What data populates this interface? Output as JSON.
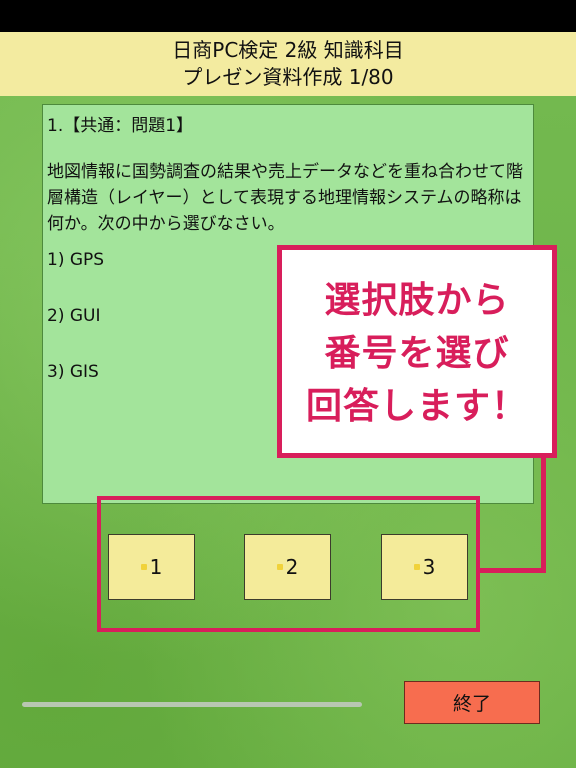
{
  "header": {
    "title": "日商PC検定 2級 知識科目",
    "subtitle": "プレゼン資料作成 1/80"
  },
  "question": {
    "number": "1.【共通：問題1】",
    "text": "地図情報に国勢調査の結果や売上データなどを重ね合わせて階層構造（レイヤー）として表現する地理情報システムの略称は何か。次の中から選びなさい。",
    "choices": [
      "1) GPS",
      "2) GUI",
      "3) GIS"
    ]
  },
  "callout": {
    "lines": [
      "選択肢から",
      "番号を選び",
      "回答します！"
    ]
  },
  "answers": [
    "1",
    "2",
    "3"
  ],
  "end_button": "終了",
  "colors": {
    "accent": "#d81e5b",
    "header_bg": "#f3eba0",
    "question_bg": "#a3e49b",
    "answer_bg": "#f4eb9a",
    "end_bg": "#f76d4f"
  }
}
